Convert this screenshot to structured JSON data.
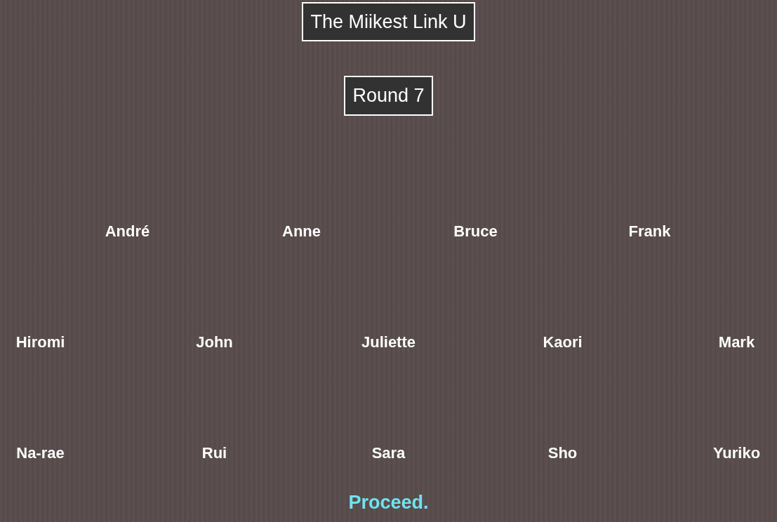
{
  "title": "The Miikest Link U",
  "round": "Round 7",
  "player_rows": [
    {
      "players": [
        {
          "name": "André"
        },
        {
          "name": "Anne"
        },
        {
          "name": "Bruce"
        },
        {
          "name": "Frank"
        }
      ]
    },
    {
      "players": [
        {
          "name": "Hiromi"
        },
        {
          "name": "John"
        },
        {
          "name": "Juliette"
        },
        {
          "name": "Kaori"
        },
        {
          "name": "Mark"
        }
      ]
    },
    {
      "players": [
        {
          "name": "Na-rae"
        },
        {
          "name": "Rui"
        },
        {
          "name": "Sara"
        },
        {
          "name": "Sho"
        },
        {
          "name": "Yuriko"
        }
      ]
    }
  ],
  "proceed_link": "Proceed."
}
